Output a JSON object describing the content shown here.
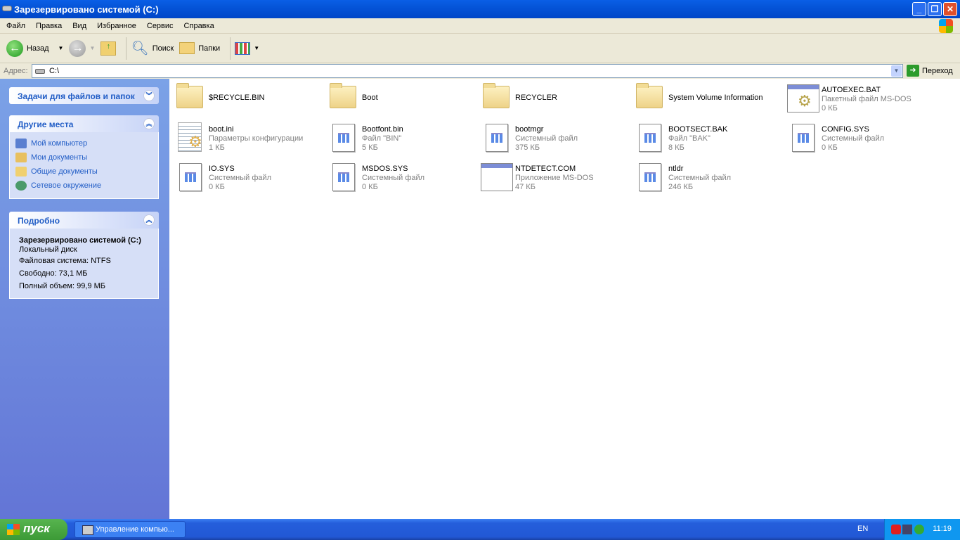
{
  "window": {
    "title": "Зарезервировано системой (C:)"
  },
  "menu": [
    "Файл",
    "Правка",
    "Вид",
    "Избранное",
    "Сервис",
    "Справка"
  ],
  "toolbar": {
    "back": "Назад",
    "search": "Поиск",
    "folders": "Папки"
  },
  "address": {
    "label": "Адрес:",
    "value": "C:\\",
    "go": "Переход"
  },
  "sidebar": {
    "tasks_title": "Задачи для файлов и папок",
    "places_title": "Другие места",
    "places": [
      "Мой компьютер",
      "Мои документы",
      "Общие документы",
      "Сетевое окружение"
    ],
    "details_title": "Подробно",
    "details": {
      "name": "Зарезервировано системой (C:)",
      "type": "Локальный диск",
      "fs": "Файловая система: NTFS",
      "free": "Свободно: 73,1 МБ",
      "total": "Полный объем: 99,9 МБ"
    }
  },
  "files": [
    {
      "name": "$RECYCLE.BIN",
      "icon": "folder"
    },
    {
      "name": "Boot",
      "icon": "folder"
    },
    {
      "name": "RECYCLER",
      "icon": "folder"
    },
    {
      "name": "System Volume Information",
      "icon": "folder"
    },
    {
      "name": "AUTOEXEC.BAT",
      "type": "Пакетный файл MS-DOS",
      "size": "0 КБ",
      "icon": "batch"
    },
    {
      "name": "boot.ini",
      "type": "Параметры конфигурации",
      "size": "1 КБ",
      "icon": "ini"
    },
    {
      "name": "Bootfont.bin",
      "type": "Файл \"BIN\"",
      "size": "5 КБ",
      "icon": "sys"
    },
    {
      "name": "bootmgr",
      "type": "Системный файл",
      "size": "375 КБ",
      "icon": "sys"
    },
    {
      "name": "BOOTSECT.BAK",
      "type": "Файл \"BAK\"",
      "size": "8 КБ",
      "icon": "sys"
    },
    {
      "name": "CONFIG.SYS",
      "type": "Системный файл",
      "size": "0 КБ",
      "icon": "sys"
    },
    {
      "name": "IO.SYS",
      "type": "Системный файл",
      "size": "0 КБ",
      "icon": "sys"
    },
    {
      "name": "MSDOS.SYS",
      "type": "Системный файл",
      "size": "0 КБ",
      "icon": "sys"
    },
    {
      "name": "NTDETECT.COM",
      "type": "Приложение MS-DOS",
      "size": "47 КБ",
      "icon": "app"
    },
    {
      "name": "ntldr",
      "type": "Системный файл",
      "size": "246 КБ",
      "icon": "sys"
    }
  ],
  "taskbar": {
    "start": "пуск",
    "task": "Управление компью...",
    "lang": "EN",
    "clock": "11:19"
  }
}
